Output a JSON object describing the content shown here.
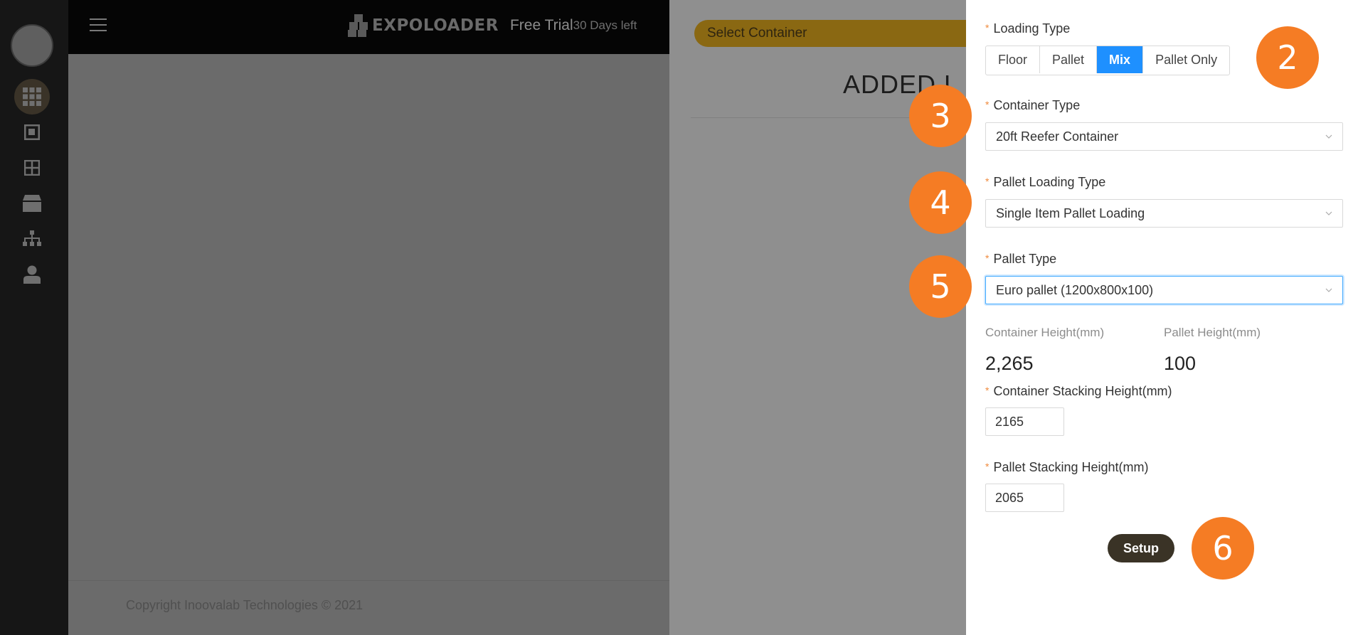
{
  "rail": {
    "icons": [
      "grid-icon",
      "square-icon",
      "layout-icon",
      "box-icon",
      "sitemap-icon",
      "user-icon"
    ]
  },
  "topbar": {
    "brand_name": "EXPOLOADER",
    "trial_label": "Free Trial",
    "days_left": "30 Days left"
  },
  "footer": {
    "text": "Copyright Inoovalab Technologies © 2021"
  },
  "drawer": {
    "select_container": "Select Container",
    "added_heading": "ADDED L"
  },
  "form": {
    "loading_type_label": "Loading Type",
    "loading_types": [
      "Floor",
      "Pallet",
      "Mix",
      "Pallet Only"
    ],
    "loading_type_selected": "Mix",
    "container_type_label": "Container Type",
    "container_type_value": "20ft Reefer Container",
    "pallet_loading_type_label": "Pallet Loading Type",
    "pallet_loading_type_value": "Single Item Pallet Loading",
    "pallet_type_label": "Pallet Type",
    "pallet_type_value": "Euro pallet (1200x800x100)",
    "container_height_label": "Container Height(mm)",
    "container_height_value": "2,265",
    "pallet_height_label": "Pallet Height(mm)",
    "pallet_height_value": "100",
    "container_stacking_label": "Container Stacking Height(mm)",
    "container_stacking_value": "2165",
    "pallet_stacking_label": "Pallet Stacking Height(mm)",
    "pallet_stacking_value": "2065",
    "setup_label": "Setup"
  },
  "markers": [
    "2",
    "3",
    "4",
    "5",
    "6"
  ],
  "colors": {
    "accent": "#1e90ff",
    "marker": "#f57c24",
    "setup": "#3a3326",
    "required": "#f08a3c"
  }
}
